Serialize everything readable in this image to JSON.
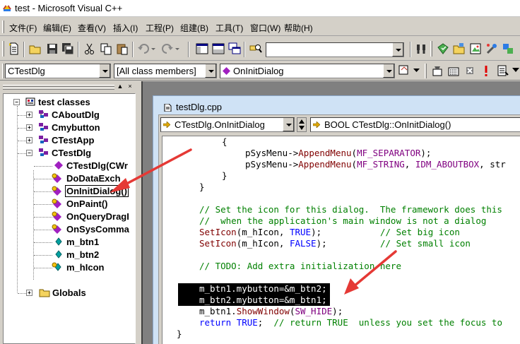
{
  "window": {
    "title": "test - Microsoft Visual C++"
  },
  "menu": [
    "文件(F)",
    "编辑(E)",
    "查看(V)",
    "插入(I)",
    "工程(P)",
    "组建(B)",
    "工具(T)",
    "窗口(W)",
    "帮助(H)"
  ],
  "toolbar": {
    "find_value": ""
  },
  "wizardbar": {
    "class_combo": "CTestDlg",
    "filter_combo": "[All class members]",
    "member_combo": "OnInitDialog"
  },
  "classview": {
    "root": "test classes",
    "items": [
      {
        "label": "CAboutDlg"
      },
      {
        "label": "Cmybutton"
      },
      {
        "label": "CTestApp"
      },
      {
        "label": "CTestDlg"
      },
      {
        "label": "CTestDlg(CWr"
      },
      {
        "label": "DoDataExch"
      },
      {
        "label": "OnInitDialog()"
      },
      {
        "label": "OnPaint()"
      },
      {
        "label": "OnQueryDragI"
      },
      {
        "label": "OnSysComma"
      },
      {
        "label": "m_btn1"
      },
      {
        "label": "m_btn2"
      },
      {
        "label": "m_hIcon"
      },
      {
        "label": "Globals"
      }
    ]
  },
  "document": {
    "title": "testDlg.cpp",
    "scope_combo": "CTestDlg.OnInitDialog",
    "function_combo": "BOOL CTestDlg::OnInitDialog()"
  },
  "code": {
    "l1": "{",
    "l2_var": "pSysMenu->",
    "l2_fn": "AppendMenu",
    "l2_open": "(",
    "l2_mac": "MF_SEPARATOR",
    "l2_close": ");",
    "l3_var": "pSysMenu->",
    "l3_fn": "AppendMenu",
    "l3_open": "(",
    "l3_mac1": "MF_STRING",
    "l3_mid": ", ",
    "l3_mac2": "IDM_ABOUTBOX",
    "l3_rest": ", str",
    "l4": "}",
    "l5": "}",
    "l6": "// Set the icon for this dialog.  The framework does this",
    "l7": "//  when the application's main window is not a dialog",
    "l8_fn": "SetIcon",
    "l8_a": "(m_hIcon, ",
    "l8_kw": "TRUE",
    "l8_b": ");",
    "l8_cm": "// Set big icon",
    "l9_fn": "SetIcon",
    "l9_a": "(m_hIcon, ",
    "l9_kw": "FALSE",
    "l9_b": ");",
    "l9_cm": "// Set small icon",
    "l10": "// TODO: Add extra initialization here",
    "l11": "m_btn1.mybutton=&m_btn2;",
    "l12": "m_btn2.mybutton=&m_btn1;",
    "l13_a": "m_btn1.",
    "l13_fn": "ShowWindow",
    "l13_b": "(",
    "l13_mac": "SW_HIDE",
    "l13_c": ");",
    "l14_kw": "return",
    "l14_kw2": "TRUE",
    "l14_b": ";  ",
    "l14_cm": "// return TRUE  unless you set the focus to",
    "l15": "}"
  },
  "colors": {
    "annotation_arrow": "#e53935",
    "keyword": "#0000ff",
    "comment": "#008000"
  }
}
